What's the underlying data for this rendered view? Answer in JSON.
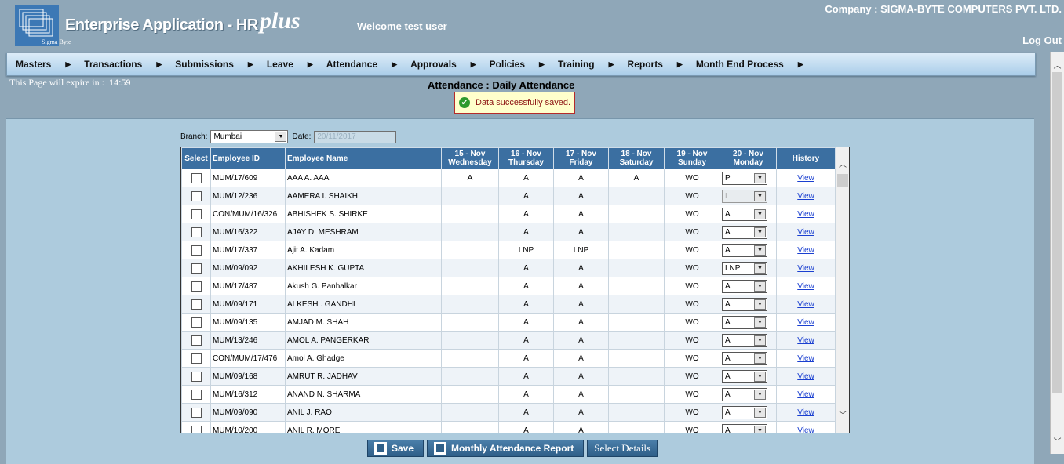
{
  "header": {
    "logo_text": "Sigma Byte",
    "app_title": "Enterprise Application - HR",
    "app_plus": "plus",
    "welcome": "Welcome test user",
    "company": "Company : SIGMA-BYTE COMPUTERS PVT. LTD.",
    "logout": "Log Out"
  },
  "menu": [
    "Masters",
    "Transactions",
    "Submissions",
    "Leave",
    "Attendance",
    "Approvals",
    "Policies",
    "Training",
    "Reports",
    "Month End Process"
  ],
  "session": {
    "label": "This Page will expire in :",
    "time": "14:59"
  },
  "page_title": "Attendance : Daily Attendance",
  "message": "Data successfully saved.",
  "filters": {
    "branch_label": "Branch:",
    "branch_value": "Mumbai",
    "date_label": "Date:",
    "date_value": "20/11/2017"
  },
  "table": {
    "headers": {
      "select": "Select",
      "employee_id": "Employee ID",
      "employee_name": "Employee Name",
      "d1": [
        "15 - Nov",
        "Wednesday"
      ],
      "d2": [
        "16 - Nov",
        "Thursday"
      ],
      "d3": [
        "17 - Nov",
        "Friday"
      ],
      "d4": [
        "18 - Nov",
        "Saturday"
      ],
      "d5": [
        "19 - Nov",
        "Sunday"
      ],
      "d6": [
        "20 - Nov",
        "Monday"
      ],
      "history": "History"
    },
    "view_label": "View",
    "rows": [
      {
        "id": "MUM/17/609",
        "name": "AAA A. AAA",
        "d1": "A",
        "d2": "A",
        "d3": "A",
        "d4": "A",
        "d5": "WO",
        "d6": "P",
        "disabled": false
      },
      {
        "id": "MUM/12/236",
        "name": "AAMERA I. SHAIKH",
        "d1": "",
        "d2": "A",
        "d3": "A",
        "d4": "",
        "d5": "WO",
        "d6": "L",
        "disabled": true
      },
      {
        "id": "CON/MUM/16/326",
        "name": "ABHISHEK S. SHIRKE",
        "d1": "",
        "d2": "A",
        "d3": "A",
        "d4": "",
        "d5": "WO",
        "d6": "A",
        "disabled": false
      },
      {
        "id": "MUM/16/322",
        "name": "AJAY D. MESHRAM",
        "d1": "",
        "d2": "A",
        "d3": "A",
        "d4": "",
        "d5": "WO",
        "d6": "A",
        "disabled": false
      },
      {
        "id": "MUM/17/337",
        "name": "Ajit A. Kadam",
        "d1": "",
        "d2": "LNP",
        "d3": "LNP",
        "d4": "",
        "d5": "WO",
        "d6": "A",
        "disabled": false
      },
      {
        "id": "MUM/09/092",
        "name": "AKHILESH K. GUPTA",
        "d1": "",
        "d2": "A",
        "d3": "A",
        "d4": "",
        "d5": "WO",
        "d6": "LNP",
        "disabled": false
      },
      {
        "id": "MUM/17/487",
        "name": "Akush G. Panhalkar",
        "d1": "",
        "d2": "A",
        "d3": "A",
        "d4": "",
        "d5": "WO",
        "d6": "A",
        "disabled": false
      },
      {
        "id": "MUM/09/171",
        "name": "ALKESH . GANDHI",
        "d1": "",
        "d2": "A",
        "d3": "A",
        "d4": "",
        "d5": "WO",
        "d6": "A",
        "disabled": false
      },
      {
        "id": "MUM/09/135",
        "name": "AMJAD M. SHAH",
        "d1": "",
        "d2": "A",
        "d3": "A",
        "d4": "",
        "d5": "WO",
        "d6": "A",
        "disabled": false
      },
      {
        "id": "MUM/13/246",
        "name": "AMOL A. PANGERKAR",
        "d1": "",
        "d2": "A",
        "d3": "A",
        "d4": "",
        "d5": "WO",
        "d6": "A",
        "disabled": false
      },
      {
        "id": "CON/MUM/17/476",
        "name": "Amol A. Ghadge",
        "d1": "",
        "d2": "A",
        "d3": "A",
        "d4": "",
        "d5": "WO",
        "d6": "A",
        "disabled": false
      },
      {
        "id": "MUM/09/168",
        "name": "AMRUT R. JADHAV",
        "d1": "",
        "d2": "A",
        "d3": "A",
        "d4": "",
        "d5": "WO",
        "d6": "A",
        "disabled": false
      },
      {
        "id": "MUM/16/312",
        "name": "ANAND N. SHARMA",
        "d1": "",
        "d2": "A",
        "d3": "A",
        "d4": "",
        "d5": "WO",
        "d6": "A",
        "disabled": false
      },
      {
        "id": "MUM/09/090",
        "name": "ANIL J. RAO",
        "d1": "",
        "d2": "A",
        "d3": "A",
        "d4": "",
        "d5": "WO",
        "d6": "A",
        "disabled": false
      },
      {
        "id": "MUM/10/200",
        "name": "ANIL R. MORE",
        "d1": "",
        "d2": "A",
        "d3": "A",
        "d4": "",
        "d5": "WO",
        "d6": "A",
        "disabled": false
      }
    ]
  },
  "buttons": {
    "save": "Save",
    "monthly_report": "Monthly Attendance Report",
    "select_details": "Select Details"
  },
  "colors": {
    "background": "#8fa7b8",
    "panel": "#adcbdd",
    "header_row": "#3b6fa1",
    "link": "#1a3fd0",
    "success": "#2e9a2e"
  }
}
